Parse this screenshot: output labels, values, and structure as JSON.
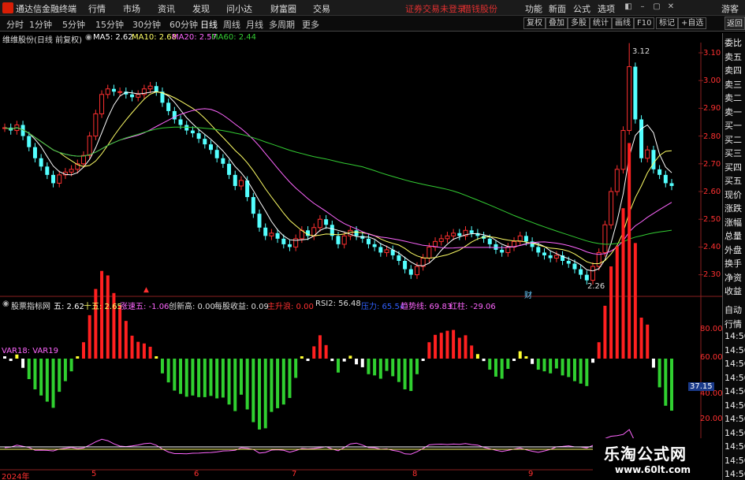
{
  "titlebar": {
    "app_name": "通达信金融终端",
    "menus": [
      "行情",
      "市场",
      "资讯",
      "发现",
      "问小达",
      "财富圈",
      "交易"
    ],
    "notice": "证券交易未登录",
    "notice2": "借钱股份",
    "right_menus": [
      "功能",
      "新面",
      "公式",
      "选项"
    ],
    "guest": "游客"
  },
  "toolbar": {
    "periods": [
      "分时",
      "1分钟",
      "5分钟",
      "15分钟",
      "30分钟",
      "60分钟",
      "日线",
      "周线",
      "月线",
      "多周期",
      "更多"
    ],
    "active_period": "日线",
    "buttons": [
      "复权",
      "叠加",
      "多股",
      "统计",
      "画线",
      "F10",
      "标记",
      "+自选"
    ],
    "close": "返回"
  },
  "main_chart": {
    "stock_name": "维维股份(日线 前复权)",
    "ma5_label": "MA5: 2.62",
    "ma10_label": "MA10: 2.68",
    "ma20_label": "MA20: 2.57",
    "ma60_label": "MA60: 2.44",
    "high_label": "3.12",
    "low_label": "2.26",
    "marker_label": "财",
    "price_ticks": [
      "3.10",
      "3.00",
      "2.90",
      "2.80",
      "2.70",
      "2.60",
      "2.50",
      "2.40",
      "2.30"
    ]
  },
  "indicator": {
    "name": "股票指标网",
    "wu": "五: 2.62",
    "shiwu": "十五: 2.65",
    "zhangsuwu": "涨速五: -1.06",
    "chuangxingao": "创新高: 0.00",
    "meigushouyi": "每股收益: 0.09",
    "zhushengdian": "主升浪: 0.00",
    "rsi2": "RSI2: 56.48",
    "yali": "压力: 65.54",
    "qushixian": "趋势线: 69.83",
    "hongzhu": "红柱: -29.06",
    "var_label": "VAR18: VAR19",
    "ticks": [
      "80.00",
      "60.00",
      "40.00",
      "20.00"
    ],
    "current_value": "37.15"
  },
  "dates": [
    "2024年",
    "5",
    "6",
    "7",
    "8",
    "9"
  ],
  "side_panel": [
    "委比",
    "卖五",
    "卖四",
    "卖三",
    "卖二",
    "卖一",
    "买一",
    "买二",
    "买三",
    "买四",
    "买五",
    "现价",
    "涨跌",
    "涨幅",
    "总量",
    "外盘",
    "换手",
    "净资",
    "收益",
    "自动",
    "行情",
    "14:50",
    "14:50",
    "14:50",
    "14:50",
    "14:50",
    "14:50",
    "14:50",
    "14:50",
    "14:50",
    "14:50",
    "14:50"
  ],
  "watermark": {
    "title": "乐淘公式网",
    "url": "www.60lt.com"
  },
  "colors": {
    "up": "#ff3030",
    "down": "#54ffff",
    "ma5": "#ffffff",
    "ma10": "#ffff66",
    "ma20": "#ff66ff",
    "ma60": "#33cc33",
    "bar_red": "#ff2020",
    "bar_yellow": "#ffff30",
    "bar_green": "#30d030",
    "bar_white": "#ffffff"
  }
}
